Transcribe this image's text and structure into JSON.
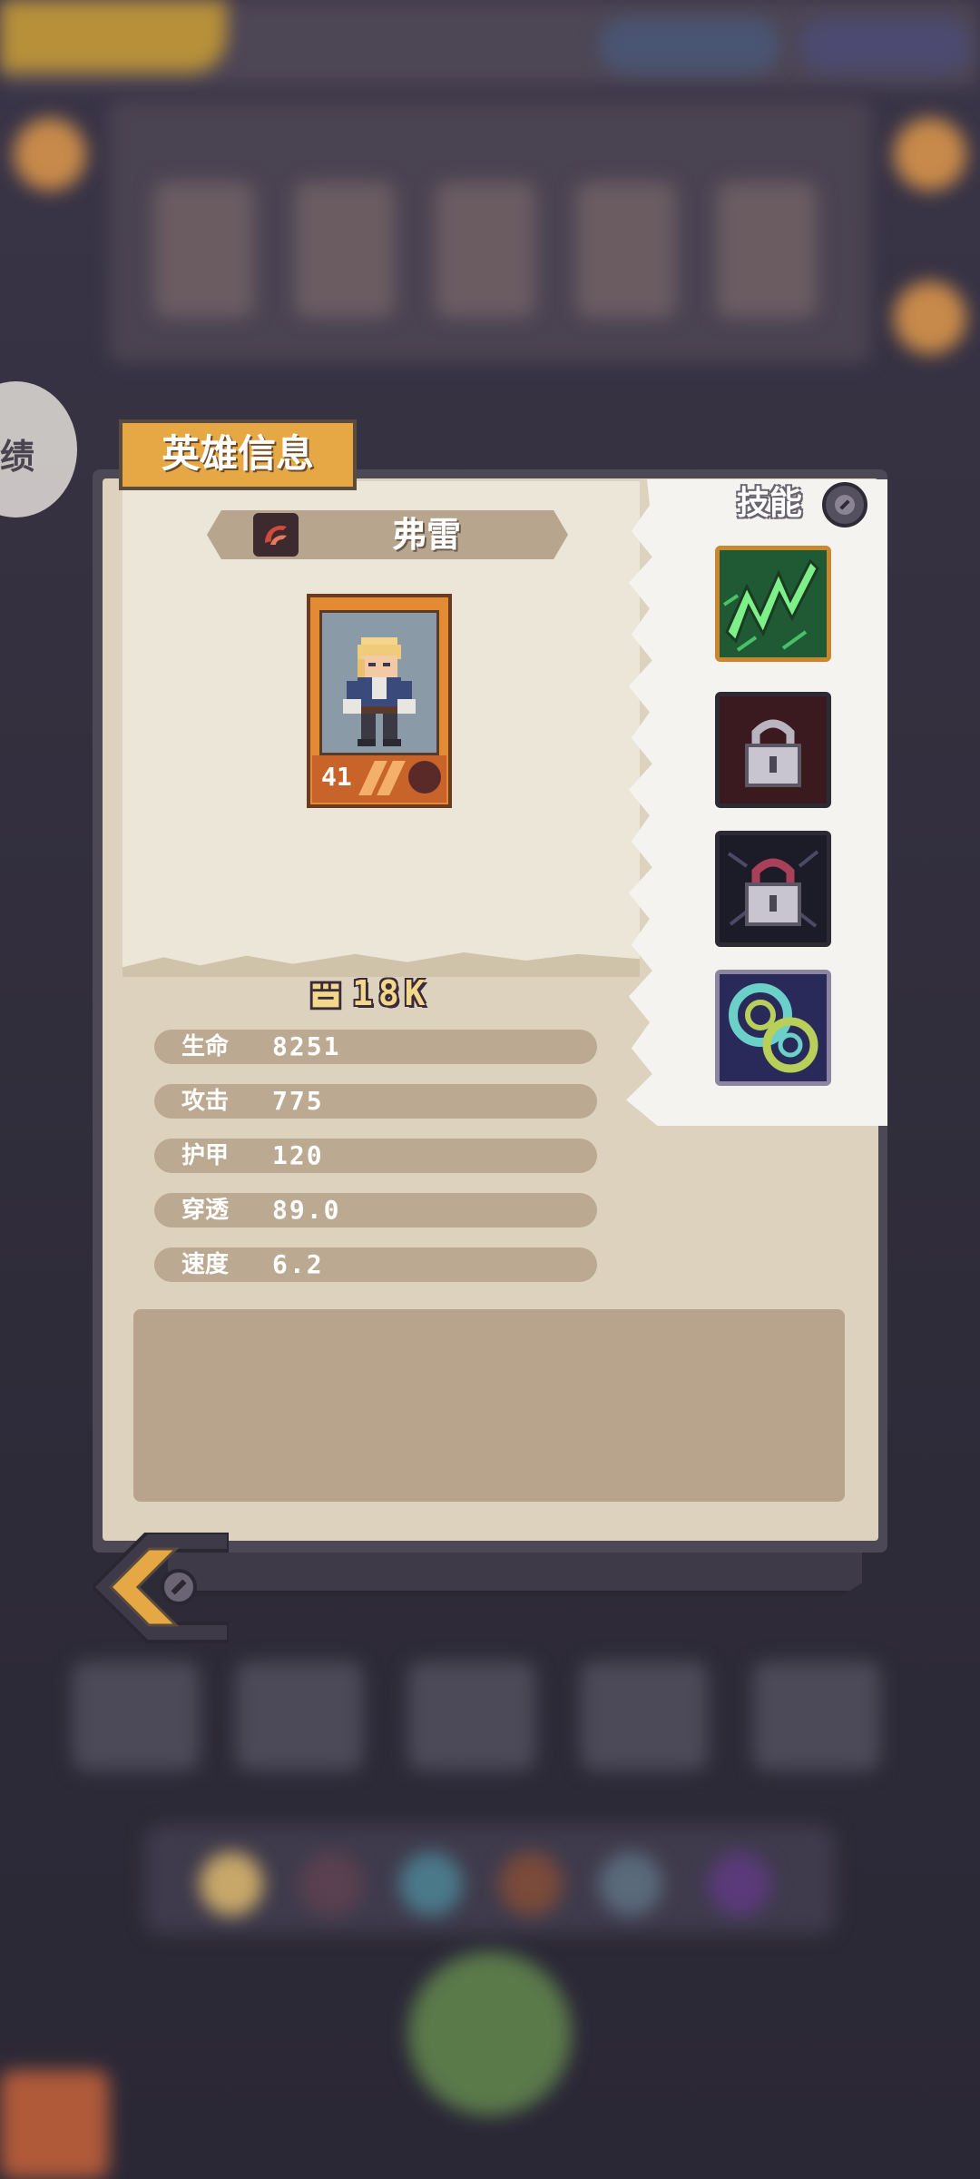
{
  "background": {
    "side_label": "绩"
  },
  "panel": {
    "title": "英雄信息",
    "hero_name": "弗雷",
    "hero_level": "41",
    "power": "18K",
    "stats": [
      {
        "label": "生命",
        "value": "8251"
      },
      {
        "label": "攻击",
        "value": "775"
      },
      {
        "label": "护甲",
        "value": "120"
      },
      {
        "label": "穿透",
        "value": "89.0"
      },
      {
        "label": "速度",
        "value": "6.2"
      }
    ],
    "description": ""
  },
  "skills": {
    "title": "技能",
    "slots": [
      {
        "icon": "lightning-skill-icon",
        "locked": false
      },
      {
        "icon": "locked-skill-icon",
        "locked": true
      },
      {
        "icon": "locked-skill-icon",
        "locked": true
      },
      {
        "icon": "spiral-skill-icon",
        "locked": false
      }
    ]
  },
  "colors": {
    "accent_gold": "#e5a845",
    "paper": "#dcd2bd",
    "stat_pill": "#bca992",
    "power_text": "#f2d88a"
  }
}
